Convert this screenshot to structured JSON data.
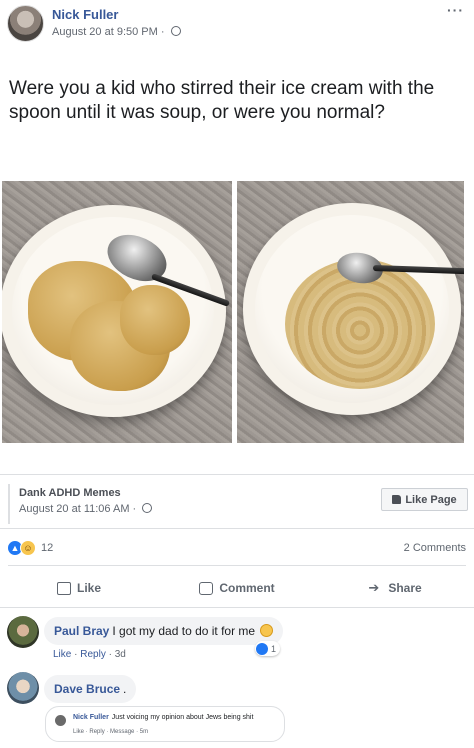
{
  "post": {
    "author": "Nick Fuller",
    "timestamp": "August 20 at 9:50 PM",
    "more_label": "···",
    "caption": "Were you a kid who stirred their ice cream with the spoon until it was soup, or were you normal?"
  },
  "shared_from": {
    "page_name": "Dank ADHD Memes",
    "timestamp": "August 20 at 11:06 AM",
    "like_page_label": "Like Page"
  },
  "stats": {
    "reaction_count": "12",
    "comment_count": "2 Comments"
  },
  "actions": {
    "like": "Like",
    "comment": "Comment",
    "share": "Share"
  },
  "comments": [
    {
      "author": "Paul Bray",
      "text": "I got my dad to do it for me",
      "like": "Like",
      "reply": "Reply",
      "age": "3d",
      "reaction_count": "1"
    },
    {
      "author": "Dave Bruce",
      "text": ".",
      "nested": {
        "author": "Nick Fuller",
        "text": "Just voicing my opinion about Jews being shit",
        "like": "Like",
        "reply": "Reply",
        "message": "Message",
        "age": "5m"
      }
    }
  ],
  "colors": {
    "link_blue": "#385898",
    "like_blue": "#2078f4",
    "muted": "#616770"
  }
}
